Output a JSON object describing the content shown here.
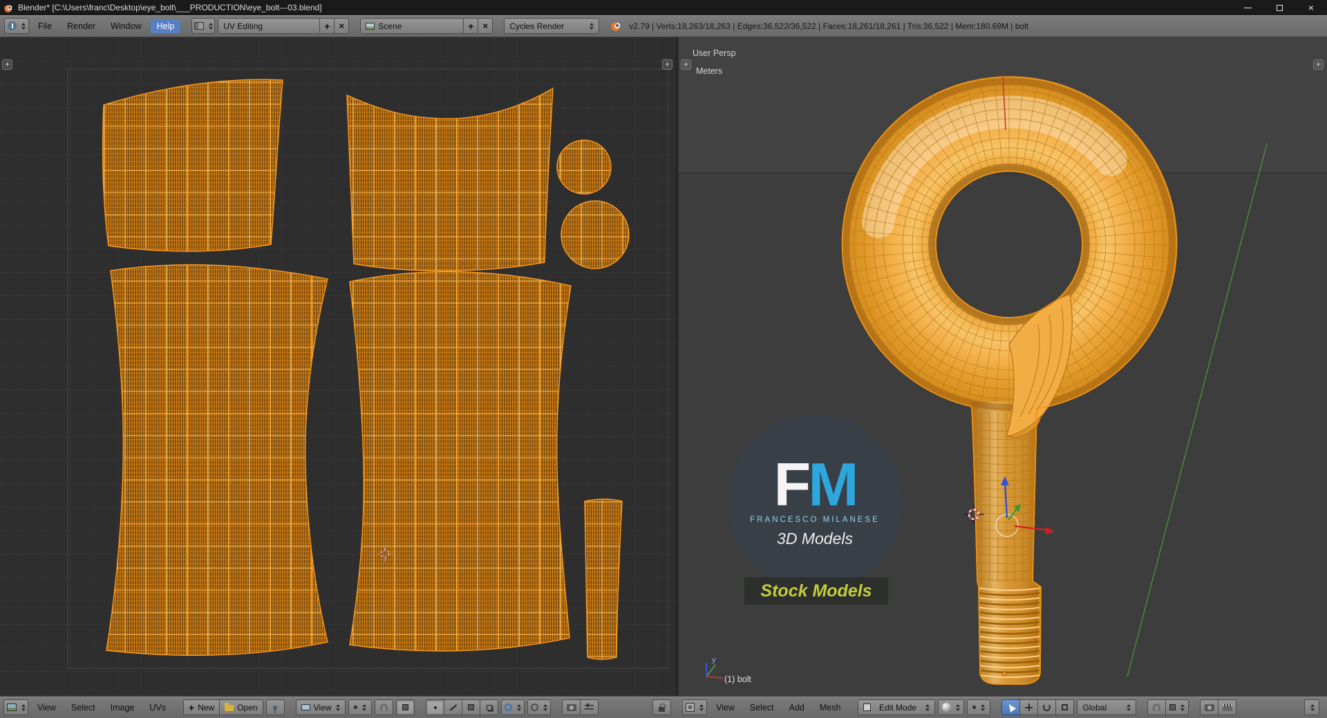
{
  "titlebar": {
    "title": "Blender* [C:\\Users\\franc\\Desktop\\eye_bolt\\___PRODUCTION\\eye_bolt---03.blend]"
  },
  "icons": {
    "plus": "+",
    "cross": "×"
  },
  "info_header": {
    "menus": [
      "File",
      "Render",
      "Window",
      "Help"
    ],
    "layout": {
      "value": "UV Editing"
    },
    "scene": {
      "value": "Scene"
    },
    "engine": {
      "value": "Cycles Render"
    },
    "stats": "v2.79 | Verts:18,263/18,263 | Edges:36,522/36,522 | Faces:18,261/18,261 | Tris:36,522 | Mem:180.69M | bolt"
  },
  "uv_editor": {
    "header": {
      "menus": [
        "View",
        "Select",
        "Image",
        "UVs"
      ],
      "new_button": "New",
      "open_button": "Open",
      "view_dropdown": "View"
    }
  },
  "viewport_3d": {
    "overlay": {
      "view_name": "User Persp",
      "units": "Meters",
      "active_object": "(1) bolt",
      "axis_label": "y"
    },
    "header": {
      "menus": [
        "View",
        "Select",
        "Add",
        "Mesh"
      ],
      "mode": "Edit Mode",
      "orientation": "Global"
    },
    "watermark": {
      "logo_f": "F",
      "logo_m": "M",
      "name": "FRANCESCO MILANESE",
      "tagline": "3D Models",
      "badge": "Stock Models"
    }
  },
  "colors": {
    "selection_orange": "#ff9d00",
    "header_gray": "#6e6e6e",
    "uv_background": "#2e2e2e",
    "viewport_background": "#3d3d3d",
    "logo_blue": "#2da7dd",
    "badge_green": "#c2cd3c"
  }
}
